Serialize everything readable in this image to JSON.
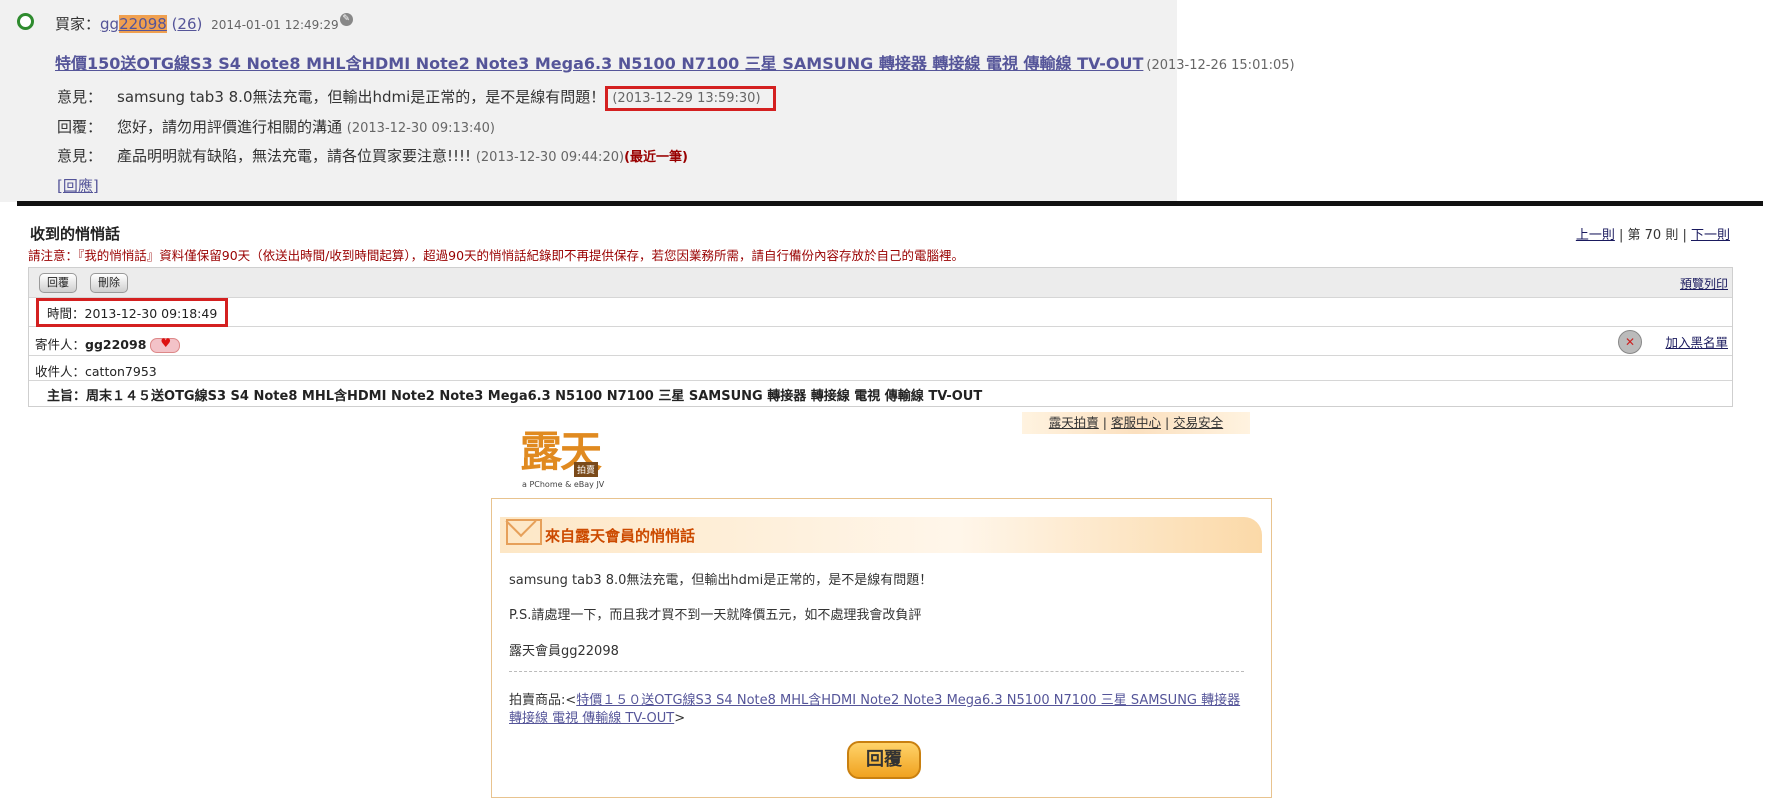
{
  "feedback": {
    "buyer_label": "買家：",
    "buyer_name_prefix": "gg",
    "buyer_name_highlight": "22098",
    "buyer_count": "26",
    "buyer_date": "2014-01-01 12:49:29",
    "item_title": "特價150送OTG線S3 S4 Note8 MHL含HDMI Note2 Note3 Mega6.3 N5100 N7100 三星 SAMSUNG 轉接器 轉接線 電視 傳輸線 TV-OUT",
    "item_date": "(2013-12-26 15:01:05)",
    "rows": [
      {
        "label": "意見：",
        "text": "samsung tab3 8.0無法充電，但輸出hdmi是正常的，是不是線有問題！",
        "date": "(2013-12-29 13:59:30)"
      },
      {
        "label": "回覆：",
        "text": "您好，請勿用評價進行相關的溝通",
        "date": "(2013-12-30 09:13:40)"
      },
      {
        "label": "意見：",
        "text": "產品明明就有缺陷，無法充電，請各位買家要注意!!!!",
        "date": "(2013-12-30 09:44:20)",
        "badge": "(最近一筆)"
      }
    ],
    "reply_link": "[回應]"
  },
  "message": {
    "title": "收到的悄悄話",
    "pager_prev": "上一則",
    "pager_mid": "第 70 則",
    "pager_next": "下一則",
    "notice": "請注意：『我的悄悄話』資料僅保留90天（依送出時間/收到時間起算），超過90天的悄悄話紀錄即不再提供保存，若您因業務所需，請自行備份內容存放於自己的電腦裡。",
    "btn_reply": "回覆",
    "btn_delete": "刪除",
    "print_preview": "預覽列印",
    "time_label": "時間：",
    "time_value": "2013-12-30 09:18:49",
    "sender_label": "寄件人：",
    "sender_value": "gg22098",
    "block_link": "加入黑名單",
    "recipient_label": "收件人：",
    "recipient_value": "catton7953",
    "subject_label": "主旨：",
    "subject_value": "周末１４５送OTG線S3 S4 Note8 MHL含HDMI Note2 Note3 Mega6.3 N5100 N7100 三星 SAMSUNG 轉接器 轉接線 電視 傳輸線 TV-OUT"
  },
  "email": {
    "links": [
      "露天拍賣",
      "客服中心",
      "交易安全"
    ],
    "logo_text": "露天",
    "logo_tag": "拍賣",
    "logo_sub": "a PChome & eBay JV",
    "heading": "來自露天會員的悄悄話",
    "line1": "samsung tab3 8.0無法充電，但輸出hdmi是正常的，是不是線有問題！",
    "line2": "P.S.請處理一下，而且我才買不到一天就降價五元，如不處理我會改負評",
    "line3": "露天會員gg22098",
    "product_label": "拍賣商品:<",
    "product_link": "特價１５０送OTG線S3 S4 Note8 MHL含HDMI Note2 Note3 Mega6.3 N5100 N7100 三星 SAMSUNG 轉接器 轉接線 電視 傳輸線 TV-OUT",
    "product_end": ">",
    "reply_button": "回覆"
  },
  "colors": {
    "highlight_box": "#d42020",
    "link": "#555599",
    "accent_orange": "#e08a20"
  }
}
